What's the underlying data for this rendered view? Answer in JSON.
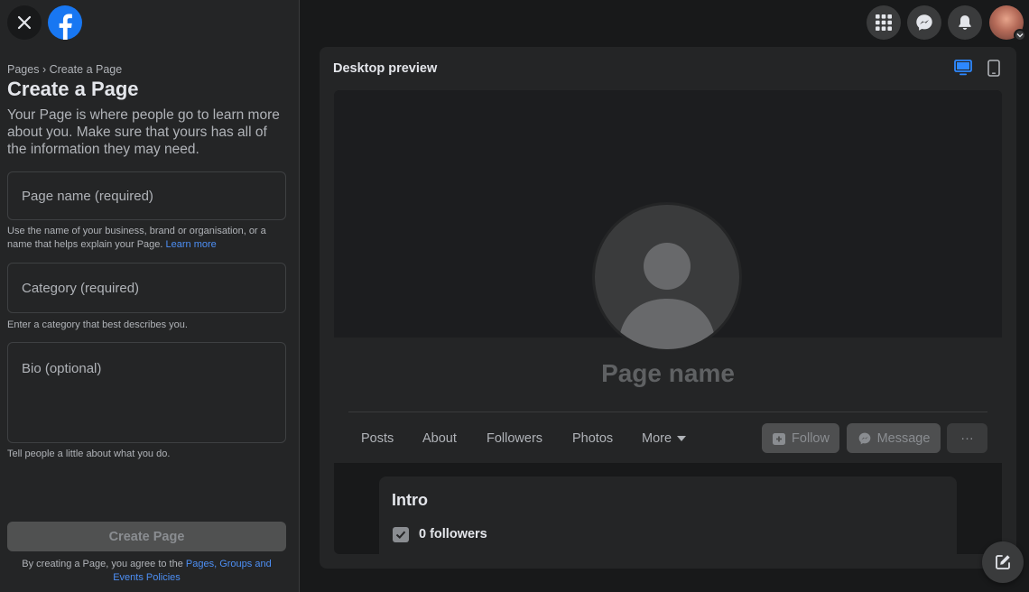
{
  "breadcrumb": {
    "parent": "Pages",
    "separator": "›",
    "current": "Create a Page"
  },
  "form": {
    "title": "Create a Page",
    "intro": "Your Page is where people go to learn more about you. Make sure that yours has all of the information they may need.",
    "page_name": {
      "placeholder": "Page name (required)",
      "value": "",
      "helper": "Use the name of your business, brand or organisation, or a name that helps explain your Page.",
      "helper_link": "Learn more"
    },
    "category": {
      "placeholder": "Category (required)",
      "value": "",
      "helper": "Enter a category that best describes you."
    },
    "bio": {
      "placeholder": "Bio (optional)",
      "value": "",
      "helper": "Tell people a little about what you do."
    },
    "submit_label": "Create Page",
    "terms_prefix": "By creating a Page, you agree to the",
    "terms_link": "Pages, Groups and Events Policies"
  },
  "preview": {
    "title": "Desktop preview",
    "page_name": "Page name",
    "tabs": [
      "Posts",
      "About",
      "Followers",
      "Photos",
      "More"
    ],
    "follow_label": "Follow",
    "message_label": "Message",
    "more_actions_label": "···",
    "intro_heading": "Intro",
    "followers_text": "0 followers"
  },
  "icons": {
    "close": "close-icon",
    "logo": "facebook-logo-icon",
    "menu": "menu-grid-icon",
    "messenger": "messenger-icon",
    "notifications": "bell-icon",
    "desktop": "desktop-icon",
    "mobile": "mobile-icon",
    "compose": "compose-icon"
  },
  "colors": {
    "brand": "#1877f2",
    "link": "#4d8ff5",
    "sidebar_bg": "#242526",
    "page_bg": "#18191a",
    "disabled_button": "#505151"
  }
}
